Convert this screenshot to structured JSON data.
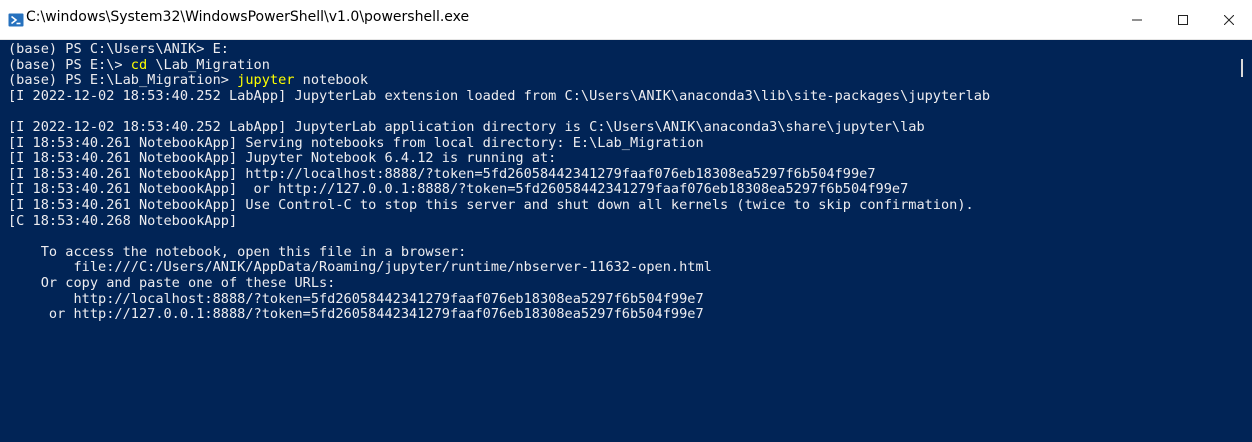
{
  "window": {
    "title": "C:\\windows\\System32\\WindowsPowerShell\\v1.0\\powershell.exe"
  },
  "titlebar_buttons": {
    "minimize": "—",
    "maximize": "☐",
    "close": "✕"
  },
  "colors": {
    "console_background": "#012456",
    "console_text": "#eeedf0",
    "command_highlight": "#ffff00"
  },
  "console": {
    "lines": [
      {
        "prefix": "(base) PS C:\\Users\\ANIK> E:",
        "cmd": "",
        "suffix": ""
      },
      {
        "prefix": "(base) PS E:\\> ",
        "cmd": "cd",
        "suffix": " \\Lab_Migration"
      },
      {
        "prefix": "(base) PS E:\\Lab_Migration> ",
        "cmd": "jupyter",
        "suffix": " notebook"
      },
      {
        "prefix": "[I 2022-12-02 18:53:40.252 LabApp] JupyterLab extension loaded from C:\\Users\\ANIK\\anaconda3\\lib\\site-packages\\jupyterlab",
        "cmd": "",
        "suffix": ""
      },
      {
        "prefix": "",
        "cmd": "",
        "suffix": ""
      },
      {
        "prefix": "[I 2022-12-02 18:53:40.252 LabApp] JupyterLab application directory is C:\\Users\\ANIK\\anaconda3\\share\\jupyter\\lab",
        "cmd": "",
        "suffix": ""
      },
      {
        "prefix": "[I 18:53:40.261 NotebookApp] Serving notebooks from local directory: E:\\Lab_Migration",
        "cmd": "",
        "suffix": ""
      },
      {
        "prefix": "[I 18:53:40.261 NotebookApp] Jupyter Notebook 6.4.12 is running at:",
        "cmd": "",
        "suffix": ""
      },
      {
        "prefix": "[I 18:53:40.261 NotebookApp] http://localhost:8888/?token=5fd26058442341279faaf076eb18308ea5297f6b504f99e7",
        "cmd": "",
        "suffix": ""
      },
      {
        "prefix": "[I 18:53:40.261 NotebookApp]  or http://127.0.0.1:8888/?token=5fd26058442341279faaf076eb18308ea5297f6b504f99e7",
        "cmd": "",
        "suffix": ""
      },
      {
        "prefix": "[I 18:53:40.261 NotebookApp] Use Control-C to stop this server and shut down all kernels (twice to skip confirmation).",
        "cmd": "",
        "suffix": ""
      },
      {
        "prefix": "[C 18:53:40.268 NotebookApp]",
        "cmd": "",
        "suffix": ""
      },
      {
        "prefix": "",
        "cmd": "",
        "suffix": ""
      },
      {
        "prefix": "    To access the notebook, open this file in a browser:",
        "cmd": "",
        "suffix": ""
      },
      {
        "prefix": "        file:///C:/Users/ANIK/AppData/Roaming/jupyter/runtime/nbserver-11632-open.html",
        "cmd": "",
        "suffix": ""
      },
      {
        "prefix": "    Or copy and paste one of these URLs:",
        "cmd": "",
        "suffix": ""
      },
      {
        "prefix": "        http://localhost:8888/?token=5fd26058442341279faaf076eb18308ea5297f6b504f99e7",
        "cmd": "",
        "suffix": ""
      },
      {
        "prefix": "     or http://127.0.0.1:8888/?token=5fd26058442341279faaf076eb18308ea5297f6b504f99e7",
        "cmd": "",
        "suffix": ""
      }
    ]
  }
}
